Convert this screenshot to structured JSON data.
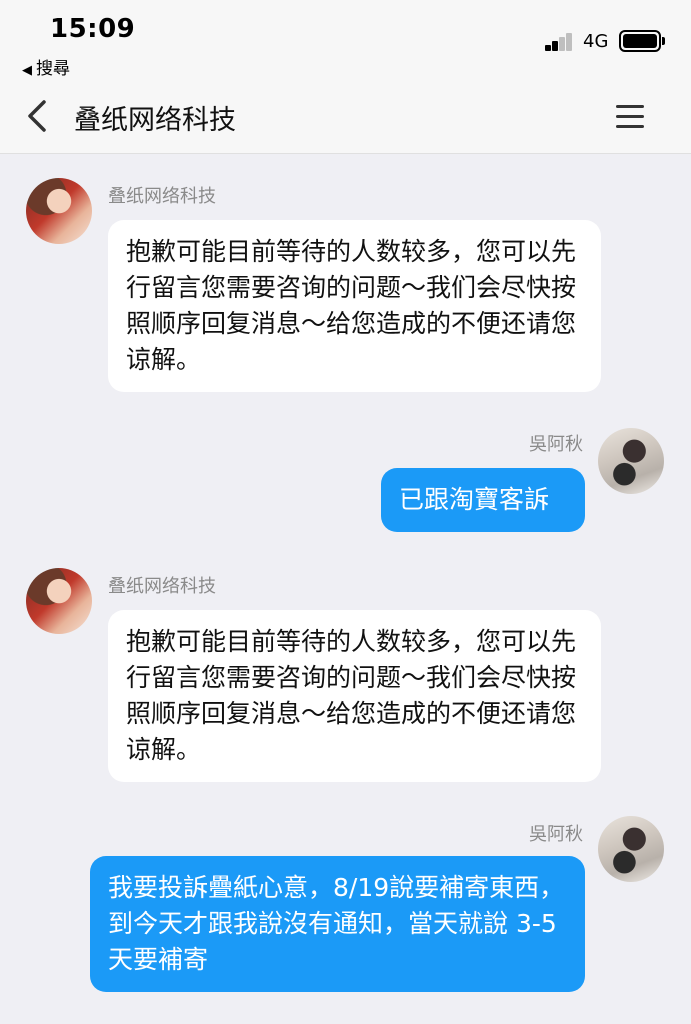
{
  "status": {
    "time": "15:09",
    "back_app": "搜尋",
    "network": "4G"
  },
  "nav": {
    "title": "叠纸网络科技"
  },
  "messages": [
    {
      "side": "incoming",
      "sender": "叠纸网络科技",
      "text": "抱歉可能目前等待的人数较多，您可以先行留言您需要咨询的问题～我们会尽快按照顺序回复消息～给您造成的不便还请您谅解。"
    },
    {
      "side": "outgoing",
      "sender": "吳阿秋",
      "text": "已跟淘寶客訴"
    },
    {
      "side": "incoming",
      "sender": "叠纸网络科技",
      "text": "抱歉可能目前等待的人数较多，您可以先行留言您需要咨询的问题～我们会尽快按照顺序回复消息～给您造成的不便还请您谅解。"
    },
    {
      "side": "outgoing",
      "sender": "吳阿秋",
      "text": "我要投訴疊紙心意，8/19說要補寄東西，到今天才跟我說沒有通知，當天就說 3-5天要補寄"
    }
  ],
  "colors": {
    "outgoing_bubble": "#1b9af7",
    "incoming_bubble": "#ffffff",
    "background": "#efeff4"
  }
}
